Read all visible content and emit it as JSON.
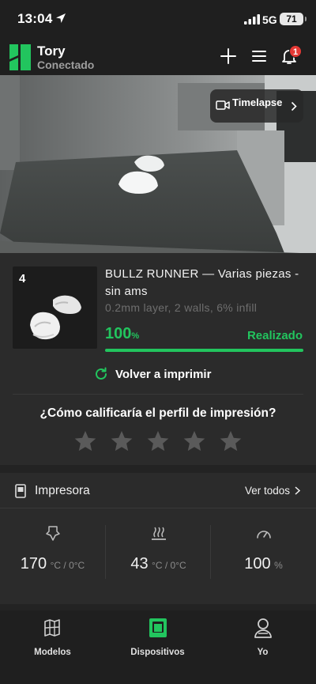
{
  "status_bar": {
    "time": "13:04",
    "network": "5G",
    "battery": "71"
  },
  "header": {
    "device_name": "Tory",
    "device_status": "Conectado",
    "notification_count": "1"
  },
  "camera": {
    "timelapse_label": "Timelapse"
  },
  "job": {
    "plate_number": "4",
    "title": "BULLZ RUNNER — Varias piezas - sin ams",
    "params": "0.2mm layer, 2 walls, 6% infill",
    "progress_value": "100",
    "progress_unit": "%",
    "progress_fraction": 1.0,
    "state": "Realizado",
    "reprint_label": "Volver a imprimir",
    "rating_question": "¿Cómo calificaría el perfil de impresión?",
    "rating_stars": 5,
    "rating_value": 0
  },
  "printer": {
    "title": "Impresora",
    "see_all": "Ver todos",
    "nozzle": {
      "value": "170",
      "unit": "°C / 0°C",
      "icon": "nozzle-icon"
    },
    "bed": {
      "value": "43",
      "unit": "°C / 0°C",
      "icon": "heatbed-icon"
    },
    "speed": {
      "value": "100",
      "unit": "%",
      "icon": "speed-gauge-icon"
    }
  },
  "tabs": [
    {
      "label": "Modelos",
      "icon": "models-icon",
      "active": false
    },
    {
      "label": "Dispositivos",
      "icon": "devices-icon",
      "active": true
    },
    {
      "label": "Yo",
      "icon": "profile-icon",
      "active": false
    }
  ],
  "colors": {
    "accent": "#22c55e",
    "background": "#232323",
    "card": "#2b2b2b",
    "badge": "#e53935"
  }
}
